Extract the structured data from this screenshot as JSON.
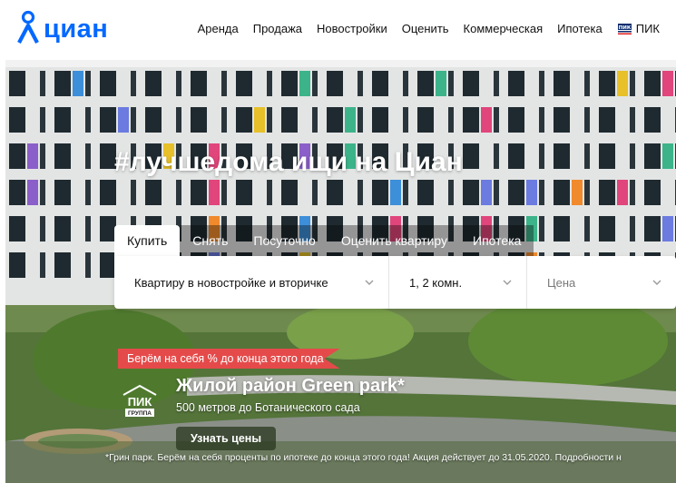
{
  "logo": {
    "text": "циан",
    "brand_color": "#0468ff"
  },
  "nav": {
    "items": [
      {
        "label": "Аренда"
      },
      {
        "label": "Продажа"
      },
      {
        "label": "Новостройки"
      },
      {
        "label": "Оценить"
      },
      {
        "label": "Коммерческая"
      },
      {
        "label": "Ипотека"
      },
      {
        "label": "ПИК",
        "icon": "pik-icon"
      }
    ]
  },
  "hero": {
    "headline": "#лучшедома ищи на Циан",
    "tabs": [
      {
        "label": "Купить",
        "active": true
      },
      {
        "label": "Снять"
      },
      {
        "label": "Посуточно"
      },
      {
        "label": "Оценить квартиру"
      },
      {
        "label": "Ипотека"
      }
    ],
    "search": {
      "type_value": "Квартиру в новостройке и вторичке",
      "rooms_value": "1, 2 комн.",
      "price_placeholder": "Цена"
    }
  },
  "promo": {
    "ribbon": "Берём на себя % до конца этого года",
    "logo_text": "ПИК",
    "logo_subtext": "ГРУППА",
    "title": "Жилой район Green park*",
    "subtitle": "500 метров до Ботанического сада",
    "button": "Узнать цены",
    "disclaimer": "*Грин парк. Берём на себя проценты по ипотеке до конца этого года! Акция действует до 31.05.2020. Подробности н",
    "ribbon_color": "#e54a4a"
  }
}
